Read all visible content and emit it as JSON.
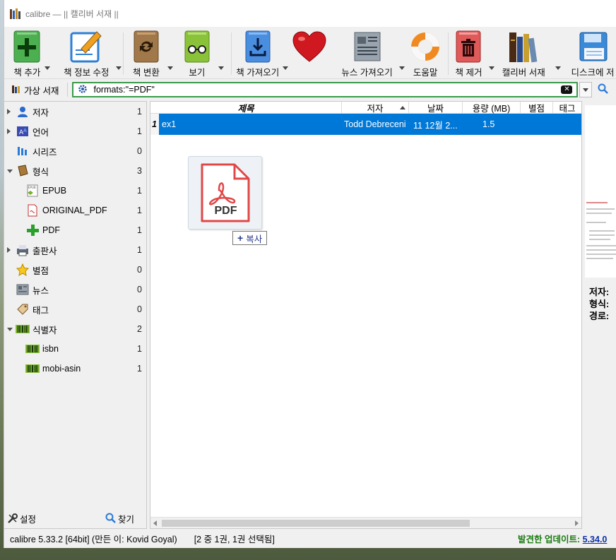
{
  "window": {
    "title": "calibre — || 캘리버 서재 ||"
  },
  "toolbar": [
    {
      "label": "책 추가",
      "icon": "add-book-icon",
      "dropdown": true
    },
    {
      "label": "책 정보 수정",
      "icon": "edit-metadata-icon",
      "dropdown": true
    },
    {
      "label": "책 변환",
      "icon": "convert-book-icon",
      "dropdown": true
    },
    {
      "label": "보기",
      "icon": "view-book-icon",
      "dropdown": true
    },
    {
      "label": "책 가져오기",
      "icon": "get-books-icon",
      "dropdown": true
    },
    {
      "label": "",
      "icon": "donate-heart-icon",
      "dropdown": false
    },
    {
      "label": "뉴스 가져오기",
      "icon": "fetch-news-icon",
      "dropdown": true
    },
    {
      "label": "도움말",
      "icon": "help-lifebuoy-icon",
      "dropdown": false
    },
    {
      "label": "책 제거",
      "icon": "remove-book-icon",
      "dropdown": true
    },
    {
      "label": "캘리버 서재",
      "icon": "calibre-library-icon",
      "dropdown": true
    },
    {
      "label": "디스크에 저",
      "icon": "save-to-disk-icon",
      "dropdown": false
    }
  ],
  "searchbar": {
    "virtual_library": "가상 서재",
    "query": "formats:\"=PDF\""
  },
  "tag_browser": [
    {
      "label": "저자",
      "count": "1",
      "icon": "person-icon",
      "level": 0,
      "arrow": "right"
    },
    {
      "label": "언어",
      "count": "1",
      "icon": "language-icon",
      "level": 0,
      "arrow": "right"
    },
    {
      "label": "시리즈",
      "count": "0",
      "icon": "series-icon",
      "level": 0,
      "arrow": ""
    },
    {
      "label": "형식",
      "count": "3",
      "icon": "format-book-icon",
      "level": 0,
      "arrow": "down"
    },
    {
      "label": "EPUB",
      "count": "1",
      "icon": "epub-icon",
      "level": 1,
      "arrow": ""
    },
    {
      "label": "ORIGINAL_PDF",
      "count": "1",
      "icon": "pdf-file-icon",
      "level": 1,
      "arrow": ""
    },
    {
      "label": "PDF",
      "count": "1",
      "icon": "plus-icon",
      "level": 1,
      "arrow": ""
    },
    {
      "label": "출판사",
      "count": "1",
      "icon": "publisher-icon",
      "level": 0,
      "arrow": "right"
    },
    {
      "label": "별점",
      "count": "0",
      "icon": "star-icon",
      "level": 0,
      "arrow": ""
    },
    {
      "label": "뉴스",
      "count": "0",
      "icon": "news-icon",
      "level": 0,
      "arrow": ""
    },
    {
      "label": "태그",
      "count": "0",
      "icon": "tag-icon",
      "level": 0,
      "arrow": ""
    },
    {
      "label": "식별자",
      "count": "2",
      "icon": "barcode-icon",
      "level": 0,
      "arrow": "down"
    },
    {
      "label": "isbn",
      "count": "1",
      "icon": "barcode-icon",
      "level": 1,
      "arrow": ""
    },
    {
      "label": "mobi-asin",
      "count": "1",
      "icon": "barcode-icon",
      "level": 1,
      "arrow": ""
    }
  ],
  "sidebar_bottom": {
    "settings": "설정",
    "find": "찾기"
  },
  "columns": {
    "title": "제목",
    "author": "저자",
    "date": "날짜",
    "size": "용량 (MB)",
    "rating": "별점",
    "tags": "태그"
  },
  "books": [
    {
      "num": "1",
      "title": "ex1",
      "author": "Todd Debreceni",
      "date": "11 12월 2...",
      "size": "1.5"
    }
  ],
  "drag": {
    "file_label": "PDF",
    "copy_label": "복사"
  },
  "details": {
    "author_label": "저자:",
    "format_label": "형식:",
    "path_label": "경로:"
  },
  "statusbar": {
    "version": "calibre 5.33.2 [64bit] (만든 이: Kovid Goyal)",
    "selection": "[2 중 1권, 1권 선택됨]",
    "update_label": "발견한 업데이트:",
    "update_version": "5.34.0"
  },
  "colors": {
    "selection": "#0078d7",
    "search_border": "#3a9a4a",
    "update_text": "#1a7a10",
    "link": "#0b2fa8"
  }
}
